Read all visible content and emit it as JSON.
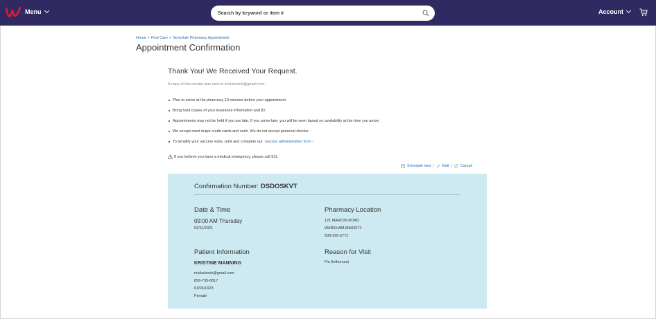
{
  "header": {
    "menu_label": "Menu",
    "search_placeholder": "Search by keyword or item #",
    "account_label": "Account",
    "brand_color": "#2f2b62",
    "logo_color": "#e31837"
  },
  "breadcrumb": {
    "items": [
      "Home",
      "Find Care",
      "Schedule Pharmacy Appointment"
    ],
    "separator": ">"
  },
  "page_title": "Appointment Confirmation",
  "thanks": {
    "heading": "Thank You! We Received Your Request.",
    "receipt_note": "A copy of this receipt was sent to mickelsonk@gmail.com."
  },
  "bullets": [
    "Plan to arrive at the pharmacy 10 minutes before your appointment.",
    "Bring hard copies of your insurance information and ID.",
    "Appointments may not be held if you are late. If you arrive late, you will be seen based on availability at the time you arrive.",
    "We accept most major credit cards and cash. We do not accept personal checks.",
    "To simplify your vaccine visits, print and complete our"
  ],
  "vaccine_link": "vaccine administration form",
  "emergency_note": "If you believe you have a medical emergency, please call 911.",
  "actions": {
    "schedule_new": "Schedule new",
    "edit": "Edit",
    "cancel": "Cancel",
    "divider": "|"
  },
  "confirmation": {
    "label": "Confirmation Number:",
    "number": "DSDOSKVT",
    "card_color": "#cde9f1",
    "date_time": {
      "title": "Date & Time",
      "time": "09:00 AM Thursday",
      "date": "02/11/2021"
    },
    "pharmacy": {
      "title": "Pharmacy Location",
      "street": "121 MARION ROAD",
      "city": "WAREHAM,MA02571",
      "phone": "508-295-5772"
    },
    "patient": {
      "title": "Patient Information",
      "name": "KRISTINE MANNING",
      "email": "mickelsonk@gmail.com",
      "phone": "858-735-8817",
      "dob": "03/06/1923",
      "gender": "Female"
    },
    "reason": {
      "title": "Reason for Visit",
      "value": "Flu (Influenza)"
    }
  }
}
